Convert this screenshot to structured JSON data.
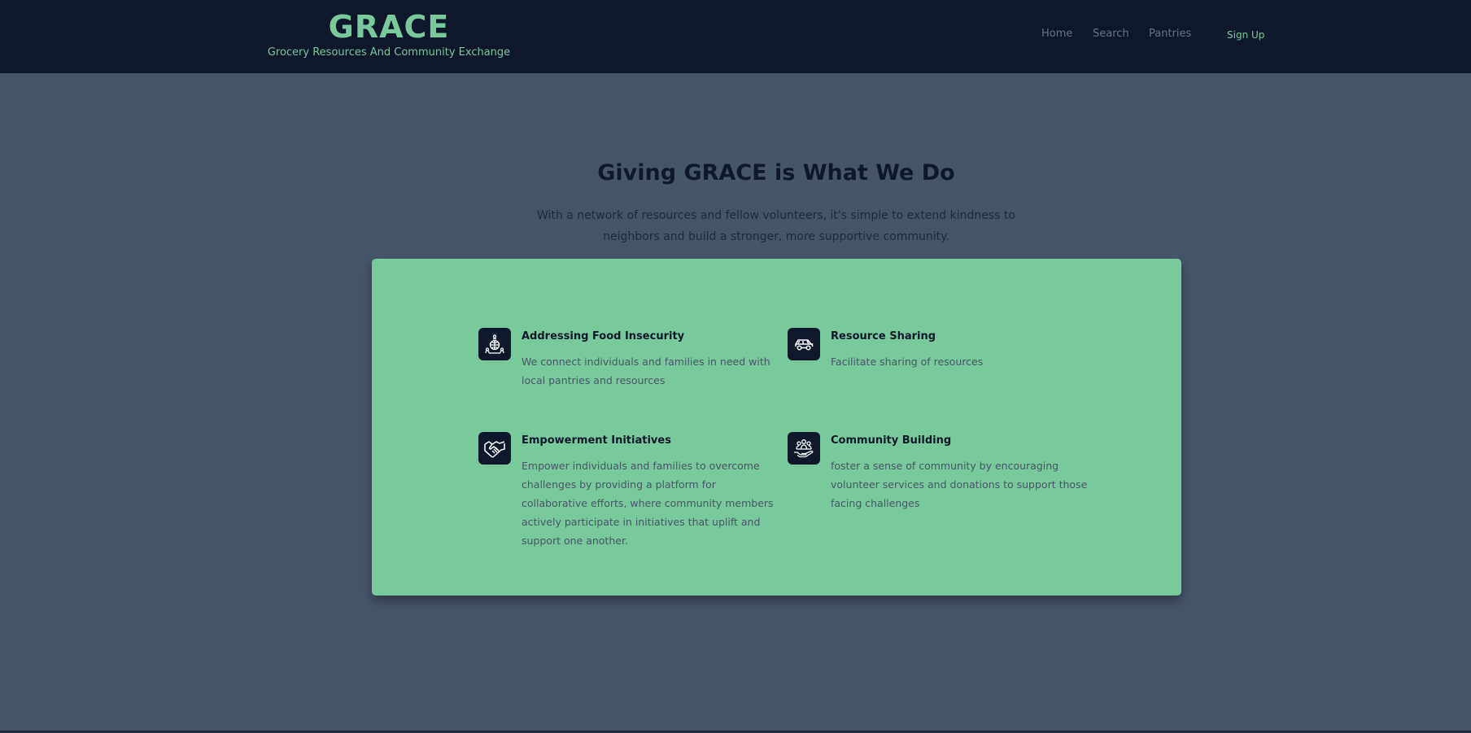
{
  "header": {
    "title": "GRACE",
    "subtitle": "Grocery Resources And Community Exchange",
    "nav": {
      "home": "Home",
      "search": "Search",
      "pantries": "Pantries",
      "signup": "Sign Up"
    }
  },
  "hero": {
    "title": "Giving GRACE is What We Do",
    "text": "With a network of resources and fellow volunteers, it's simple to extend kindness to neighbors and build a stronger, more supportive community."
  },
  "features": [
    {
      "icon": "globe-people-icon",
      "title": "Addressing Food Insecurity",
      "description": "We connect individuals and families in need with local pantries and resources"
    },
    {
      "icon": "car-icon",
      "title": "Resource Sharing",
      "description": "Facilitate sharing of resources"
    },
    {
      "icon": "handshake-icon",
      "title": "Empowerment Initiatives",
      "description": "Empower individuals and families to overcome challenges by providing a platform for collaborative efforts, where community members actively participate in initiatives that uplift and support one another."
    },
    {
      "icon": "community-hand-icon",
      "title": "Community Building",
      "description": "foster a sense of community by encouraging volunteer services and donations to support those facing challenges"
    }
  ],
  "colors": {
    "header_bg": "#0f172a",
    "page_bg": "#475569",
    "accent": "#78c99b",
    "text_dark": "#0f172a",
    "text_muted": "#475569"
  }
}
